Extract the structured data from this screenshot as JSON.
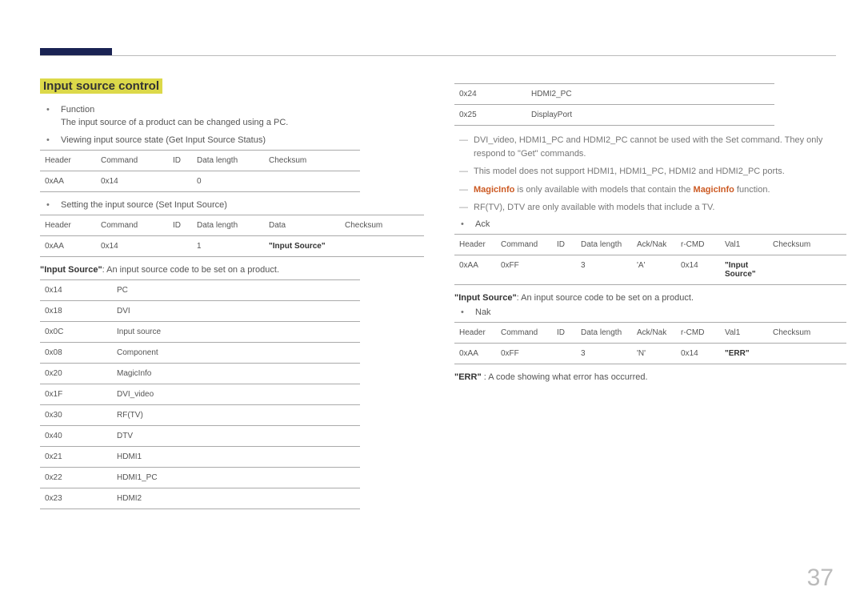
{
  "pageNumber": "37",
  "title": "Input source control",
  "left": {
    "bullet1": "Function",
    "bullet1_desc": "The input source of a product can be changed using a PC.",
    "bullet2": "Viewing input source state (Get Input Source Status)",
    "table1": {
      "headers": [
        "Header",
        "Command",
        "ID",
        "Data length",
        "Checksum"
      ],
      "row": [
        "0xAA",
        "0x14",
        "",
        "0",
        ""
      ]
    },
    "bullet3": "Setting the input source (Set Input Source)",
    "table2": {
      "headers": [
        "Header",
        "Command",
        "ID",
        "Data length",
        "Data",
        "Checksum"
      ],
      "row": [
        "0xAA",
        "0x14",
        "",
        "1",
        "\"Input Source\"",
        ""
      ]
    },
    "note1_bold": "\"Input Source\"",
    "note1_rest": ": An input source code to be set on a product.",
    "codes": [
      [
        "0x14",
        "PC"
      ],
      [
        "0x18",
        "DVI"
      ],
      [
        "0x0C",
        "Input source"
      ],
      [
        "0x08",
        "Component"
      ],
      [
        "0x20",
        "MagicInfo"
      ],
      [
        "0x1F",
        "DVI_video"
      ],
      [
        "0x30",
        "RF(TV)"
      ],
      [
        "0x40",
        "DTV"
      ],
      [
        "0x21",
        "HDMI1"
      ],
      [
        "0x22",
        "HDMI1_PC"
      ],
      [
        "0x23",
        "HDMI2"
      ]
    ]
  },
  "right": {
    "codes": [
      [
        "0x24",
        "HDMI2_PC"
      ],
      [
        "0x25",
        "DisplayPort"
      ]
    ],
    "dash1": "DVI_video, HDMI1_PC and HDMI2_PC cannot be used with the Set command. They only respond to \"Get\" commands.",
    "dash2": "This model does not support HDMI1, HDMI1_PC, HDMI2 and HDMI2_PC ports.",
    "dash3_word1": "MagicInfo",
    "dash3_mid": " is only available with models that contain the ",
    "dash3_word2": "MagicInfo",
    "dash3_end": " function.",
    "dash4": "RF(TV), DTV are only available with models that include a TV.",
    "bullet_ack": "Ack",
    "tableAck": {
      "headers": [
        "Header",
        "Command",
        "ID",
        "Data length",
        "Ack/Nak",
        "r-CMD",
        "Val1",
        "Checksum"
      ],
      "row": [
        "0xAA",
        "0xFF",
        "",
        "3",
        "'A'",
        "0x14",
        "\"Input Source\"",
        ""
      ]
    },
    "note_sourceAck_bold": "\"Input Source\"",
    "note_sourceAck_rest": ": An input source code to be set on a product.",
    "bullet_nak": "Nak",
    "tableNak": {
      "headers": [
        "Header",
        "Command",
        "ID",
        "Data length",
        "Ack/Nak",
        "r-CMD",
        "Val1",
        "Checksum"
      ],
      "row": [
        "0xAA",
        "0xFF",
        "",
        "3",
        "'N'",
        "0x14",
        "\"ERR\"",
        ""
      ]
    },
    "note_err_bold": "\"ERR\"",
    "note_err_rest": " : A code showing what error has occurred."
  }
}
